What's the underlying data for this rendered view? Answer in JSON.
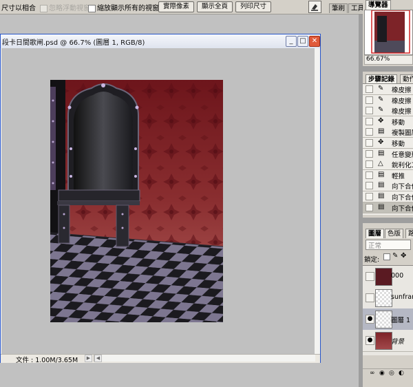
{
  "options_bar": {
    "resize_windows_label": "尺寸以相合",
    "ignore_palettes_label": "忽略浮動視窗",
    "zoom_all_windows_label": "縮放顯示所有的視窗",
    "actual_pixels_label": "實際像素",
    "fit_screen_label": "顯示全頁",
    "print_size_label": "列印尺寸",
    "brushes_tab": "筆刷",
    "tools_tab": "工具"
  },
  "document": {
    "title": "段卡日間歌闸.psd @ 66.7% (圖層 1, RGB/8)",
    "status_file": "文件 : 1.00M/3.65M",
    "minimize": "_",
    "maximize": "□",
    "close": "✕"
  },
  "navigator": {
    "tab": "導覽器",
    "zoom": "66.67%"
  },
  "history": {
    "tabs": [
      "步驟記錄",
      "動作"
    ],
    "items": [
      {
        "label": "橡皮擦",
        "icon": "eraser-icon",
        "glyph": "✎"
      },
      {
        "label": "橡皮擦",
        "icon": "eraser-icon",
        "glyph": "✎"
      },
      {
        "label": "橡皮擦",
        "icon": "eraser-icon",
        "glyph": "✎"
      },
      {
        "label": "移動",
        "icon": "move-icon",
        "glyph": "✥"
      },
      {
        "label": "複製圖層",
        "icon": "history-state-icon",
        "glyph": "▤"
      },
      {
        "label": "移動",
        "icon": "move-icon",
        "glyph": "✥"
      },
      {
        "label": "任意變形",
        "icon": "history-state-icon",
        "glyph": "▤"
      },
      {
        "label": "銳利化工具",
        "icon": "sharpen-icon",
        "glyph": "△"
      },
      {
        "label": "輕推",
        "icon": "history-state-icon",
        "glyph": "▤"
      },
      {
        "label": "向下合併",
        "icon": "history-state-icon",
        "glyph": "▤"
      },
      {
        "label": "向下合併",
        "icon": "history-state-icon",
        "glyph": "▤"
      },
      {
        "label": "向下合併",
        "icon": "history-state-icon",
        "glyph": "▤"
      }
    ]
  },
  "layers": {
    "tabs": [
      "圖層",
      "色版",
      "路徑"
    ],
    "blend_mode": "正常",
    "lock_label": "鎖定:",
    "items": [
      {
        "name": "000",
        "visible": false,
        "selected": false,
        "italic": false
      },
      {
        "name": "sunframe",
        "visible": false,
        "selected": false,
        "italic": false
      },
      {
        "name": "圖層 1",
        "visible": true,
        "selected": true,
        "italic": false
      },
      {
        "name": "背景",
        "visible": true,
        "selected": false,
        "italic": true
      }
    ]
  },
  "colors": {
    "window_border": "#2553c8",
    "close_button": "#e05a3a",
    "wallpaper": "#7a1f24",
    "floor_dark": "#1b1a1f",
    "floor_light": "#7d7690"
  }
}
